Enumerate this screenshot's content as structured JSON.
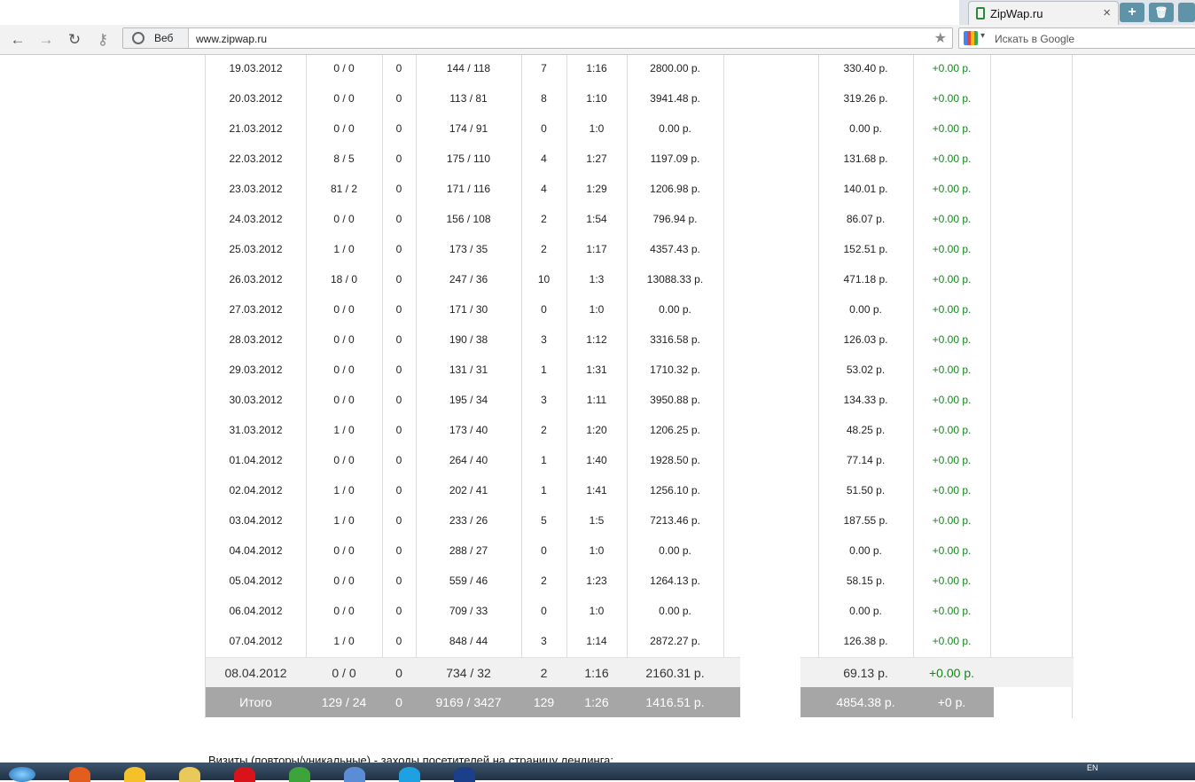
{
  "browser": {
    "tab_title": "ZipWap.ru",
    "tab_close": "×",
    "new_tab": "+",
    "trash": "🗑",
    "nav_back": "←",
    "nav_forward": "→",
    "nav_reload": "↻",
    "nav_key": "⚷",
    "address_mode": "Веб",
    "url": "www.zipwap.ru",
    "bookmark_star": "★",
    "search_placeholder": "Искать в Google",
    "search_dropdown": "▾"
  },
  "table": {
    "rows": [
      [
        "19.03.2012",
        "0 / 0",
        "0",
        "144 / 118",
        "7",
        "1:16",
        "2800.00 р.",
        "",
        "330.40 р.",
        "+0.00 р."
      ],
      [
        "20.03.2012",
        "0 / 0",
        "0",
        "113 / 81",
        "8",
        "1:10",
        "3941.48 р.",
        "",
        "319.26 р.",
        "+0.00 р."
      ],
      [
        "21.03.2012",
        "0 / 0",
        "0",
        "174 / 91",
        "0",
        "1:0",
        "0.00 р.",
        "",
        "0.00 р.",
        "+0.00 р."
      ],
      [
        "22.03.2012",
        "8 / 5",
        "0",
        "175 / 110",
        "4",
        "1:27",
        "1197.09 р.",
        "",
        "131.68 р.",
        "+0.00 р."
      ],
      [
        "23.03.2012",
        "81 / 2",
        "0",
        "171 / 116",
        "4",
        "1:29",
        "1206.98 р.",
        "",
        "140.01 р.",
        "+0.00 р."
      ],
      [
        "24.03.2012",
        "0 / 0",
        "0",
        "156 / 108",
        "2",
        "1:54",
        "796.94 р.",
        "",
        "86.07 р.",
        "+0.00 р."
      ],
      [
        "25.03.2012",
        "1 / 0",
        "0",
        "173 / 35",
        "2",
        "1:17",
        "4357.43 р.",
        "",
        "152.51 р.",
        "+0.00 р."
      ],
      [
        "26.03.2012",
        "18 / 0",
        "0",
        "247 / 36",
        "10",
        "1:3",
        "13088.33 р.",
        "",
        "471.18 р.",
        "+0.00 р."
      ],
      [
        "27.03.2012",
        "0 / 0",
        "0",
        "171 / 30",
        "0",
        "1:0",
        "0.00 р.",
        "",
        "0.00 р.",
        "+0.00 р."
      ],
      [
        "28.03.2012",
        "0 / 0",
        "0",
        "190 / 38",
        "3",
        "1:12",
        "3316.58 р.",
        "",
        "126.03 р.",
        "+0.00 р."
      ],
      [
        "29.03.2012",
        "0 / 0",
        "0",
        "131 / 31",
        "1",
        "1:31",
        "1710.32 р.",
        "",
        "53.02 р.",
        "+0.00 р."
      ],
      [
        "30.03.2012",
        "0 / 0",
        "0",
        "195 / 34",
        "3",
        "1:11",
        "3950.88 р.",
        "",
        "134.33 р.",
        "+0.00 р."
      ],
      [
        "31.03.2012",
        "1 / 0",
        "0",
        "173 / 40",
        "2",
        "1:20",
        "1206.25 р.",
        "",
        "48.25 р.",
        "+0.00 р."
      ],
      [
        "01.04.2012",
        "0 / 0",
        "0",
        "264 / 40",
        "1",
        "1:40",
        "1928.50 р.",
        "",
        "77.14 р.",
        "+0.00 р."
      ],
      [
        "02.04.2012",
        "1 / 0",
        "0",
        "202 / 41",
        "1",
        "1:41",
        "1256.10 р.",
        "",
        "51.50 р.",
        "+0.00 р."
      ],
      [
        "03.04.2012",
        "1 / 0",
        "0",
        "233 / 26",
        "5",
        "1:5",
        "7213.46 р.",
        "",
        "187.55 р.",
        "+0.00 р."
      ],
      [
        "04.04.2012",
        "0 / 0",
        "0",
        "288 / 27",
        "0",
        "1:0",
        "0.00 р.",
        "",
        "0.00 р.",
        "+0.00 р."
      ],
      [
        "05.04.2012",
        "0 / 0",
        "0",
        "559 / 46",
        "2",
        "1:23",
        "1264.13 р.",
        "",
        "58.15 р.",
        "+0.00 р."
      ],
      [
        "06.04.2012",
        "0 / 0",
        "0",
        "709 / 33",
        "0",
        "1:0",
        "0.00 р.",
        "",
        "0.00 р.",
        "+0.00 р."
      ],
      [
        "07.04.2012",
        "1 / 0",
        "0",
        "848 / 44",
        "3",
        "1:14",
        "2872.27 р.",
        "",
        "126.38 р.",
        "+0.00 р."
      ]
    ],
    "current_row": [
      "08.04.2012",
      "0 / 0",
      "0",
      "734 / 32",
      "2",
      "1:16",
      "2160.31 р.",
      "",
      "69.13 р.",
      "+0.00 р."
    ],
    "total_row": [
      "Итого",
      "129 / 24",
      "0",
      "9169 / 3427",
      "129",
      "1:26",
      "1416.51 р.",
      "",
      "4854.38 р.",
      "+0 р."
    ]
  },
  "footer_note": "Визиты (повторы/уникальные) - заходы посетителей на страницу лендинга:",
  "taskbar": {
    "lang": "EN",
    "icon_colors": [
      "#e35d1f",
      "#f5c12a",
      "#e8c95a",
      "#d9131a",
      "#3da33b",
      "#5a8dd6",
      "#1da1e2",
      "#1c3f8c"
    ]
  }
}
